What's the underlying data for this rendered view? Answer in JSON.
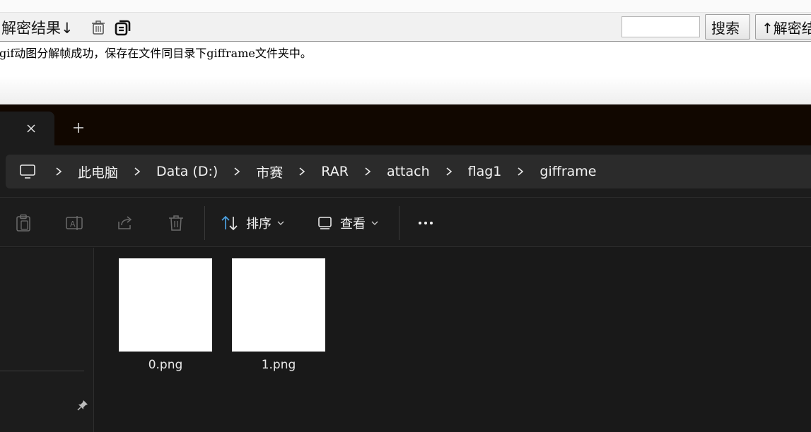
{
  "tool": {
    "decrypt_result_label": "解密结果↓",
    "search_button": "搜索",
    "decrypt_up_button": "↑解密结",
    "search_value": "",
    "output_message": "gif动图分解帧成功，保存在文件同目录下gifframe文件夹中。"
  },
  "explorer": {
    "breadcrumbs": [
      "此电脑",
      "Data (D:)",
      "市赛",
      "RAR",
      "attach",
      "flag1",
      "gifframe"
    ],
    "commands": {
      "sort_label": "排序",
      "view_label": "查看"
    },
    "files": [
      {
        "name": "0.png"
      },
      {
        "name": "1.png"
      }
    ]
  },
  "colors": {
    "explorer_bg": "#191919",
    "tabbar_bg": "#110700",
    "accent_blue": "#4ca0e0"
  }
}
